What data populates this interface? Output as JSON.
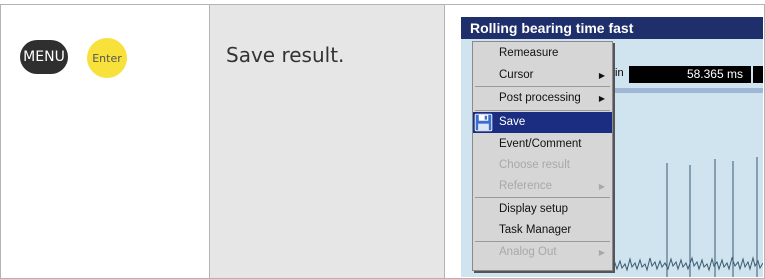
{
  "left": {
    "menu_key": "MENU",
    "enter_key": "Enter"
  },
  "middle": {
    "instruction": "Save result."
  },
  "device": {
    "title": "Rolling bearing time fast",
    "readout_tag": "in",
    "readout_value": "58.365 ms",
    "menu": [
      {
        "label": "Remeasure",
        "enabled": true,
        "submenu": false
      },
      {
        "label": "Cursor",
        "enabled": true,
        "submenu": true
      },
      {
        "label": "Post processing",
        "enabled": true,
        "submenu": true
      },
      {
        "label": "Save",
        "enabled": true,
        "submenu": false,
        "selected": true,
        "icon": "floppy-disk-icon"
      },
      {
        "label": "Event/Comment",
        "enabled": true,
        "submenu": false
      },
      {
        "label": "Choose result",
        "enabled": false,
        "submenu": false
      },
      {
        "label": "Reference",
        "enabled": false,
        "submenu": true
      },
      {
        "label": "Display setup",
        "enabled": true,
        "submenu": false
      },
      {
        "label": "Task Manager",
        "enabled": true,
        "submenu": false
      },
      {
        "label": "Analog Out",
        "enabled": false,
        "submenu": true
      }
    ],
    "colors": {
      "title_bar": "#1f2f6b",
      "selection": "#1b2d80",
      "enter_key": "#f7e13a"
    }
  }
}
